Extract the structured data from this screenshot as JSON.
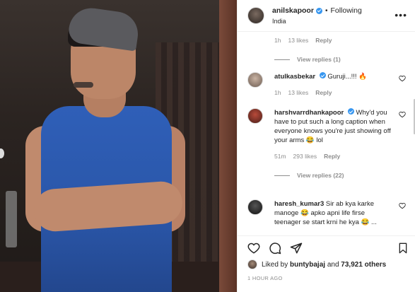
{
  "post": {
    "author": "anilskapoor",
    "separator": "•",
    "follow_state": "Following",
    "location": "India",
    "more_icon": "•••"
  },
  "comments": [
    {
      "id": "c0",
      "time": "1h",
      "likes": "13 likes",
      "reply": "Reply",
      "view_replies": "View replies (1)"
    },
    {
      "id": "c1",
      "username": "atulkasbekar",
      "text": "Guruji...!!! 🔥",
      "time": "1h",
      "likes": "13 likes",
      "reply": "Reply"
    },
    {
      "id": "c2",
      "username": "harshvarrdhankapoor",
      "text": "Why'd you have to put such a long caption when everyone knows you're just showing off your arms 😂 lol",
      "time": "51m",
      "likes": "293 likes",
      "reply": "Reply",
      "view_replies": "View replies (22)"
    },
    {
      "id": "c3",
      "username": "haresh_kumar3",
      "text": "Sir ab kya karke manoge 😂 apko apni life firse teenager se start krni he kya 😂 ..."
    }
  ],
  "actions": {
    "like_icon": "heart-icon",
    "comment_icon": "comment-icon",
    "share_icon": "share-icon",
    "save_icon": "bookmark-icon"
  },
  "liked_by": {
    "prefix": "Liked by",
    "user": "buntybajaj",
    "mid": "and",
    "others": "73,921 others"
  },
  "timestamp": "1 HOUR AGO",
  "colors": {
    "verified": "#3897f0",
    "meta_text": "#8e8e8e",
    "text": "#262626",
    "shirt": "#2f5fb8"
  }
}
